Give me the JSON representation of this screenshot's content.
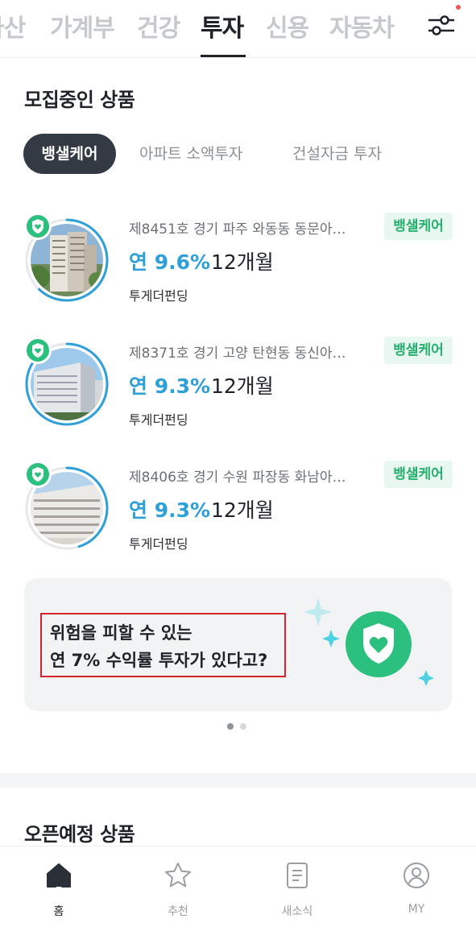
{
  "top_tabs": [
    {
      "label": "자산"
    },
    {
      "label": "가계부"
    },
    {
      "label": "건강"
    },
    {
      "label": "투자",
      "active": true
    },
    {
      "label": "신용"
    },
    {
      "label": "자동차"
    }
  ],
  "recruiting": {
    "title": "모집중인 상품",
    "chips": [
      {
        "label": "뱅샐케어",
        "active": true
      },
      {
        "label": "아파트 소액투자"
      },
      {
        "label": "건설자금 투자"
      }
    ],
    "products": [
      {
        "title": "제8451호 경기 파주 와동동 동문아…",
        "badge": "뱅샐케어",
        "rate": "연 9.6%",
        "term": "12개월",
        "partner": "투게더펀딩",
        "progress": 0.62
      },
      {
        "title": "제8371호 경기 고양 탄현동 동신아…",
        "badge": "뱅샐케어",
        "rate": "연 9.3%",
        "term": "12개월",
        "partner": "투게더펀딩",
        "progress": 0.93
      },
      {
        "title": "제8406호 경기 수원 파장동 화남아…",
        "badge": "뱅샐케어",
        "rate": "연 9.3%",
        "term": "12개월",
        "partner": "투게더펀딩",
        "progress": 0.45
      }
    ]
  },
  "banner": {
    "line1": "위험을 피할 수 있는",
    "line2": "연 7% 수익률 투자가 있다고?",
    "page_count": 2,
    "current_page": 1
  },
  "upcoming": {
    "title": "오픈예정 상품"
  },
  "bottom_nav": [
    {
      "label": "홈",
      "icon": "home-icon",
      "active": true
    },
    {
      "label": "추천",
      "icon": "star-icon"
    },
    {
      "label": "새소식",
      "icon": "news-icon"
    },
    {
      "label": "MY",
      "icon": "profile-icon"
    }
  ],
  "colors": {
    "accent_blue": "#2d9fd9",
    "accent_green": "#2cc07e",
    "badge_bg": "#e8f7ef",
    "chip_active_bg": "#333a43"
  }
}
